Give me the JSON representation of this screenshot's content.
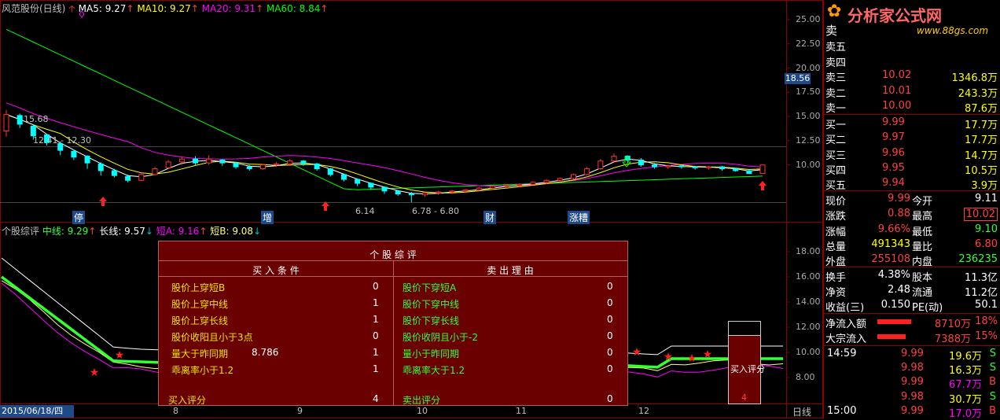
{
  "colors": {
    "up": "#ff3232",
    "down": "#00ffff",
    "ma5": "#ffffff",
    "ma10": "#ffff00",
    "ma20": "#ff00ff",
    "ma60": "#00ff00"
  },
  "header": {
    "title": "风范股份(日线)",
    "ma5": "MA5: 9.27",
    "ma10": "MA10: 9.27",
    "ma20": "MA20: 9.31",
    "ma60": "MA60: 8.84"
  },
  "price_axis": [
    "25.00",
    "22.50",
    "20.00",
    "17.50",
    "15.00",
    "12.50",
    "10.00"
  ],
  "price_marker": "18.56",
  "annotations": {
    "high": "15.68",
    "range": "12.41 - 12.30",
    "low": "6.14",
    "low2": "6.78 - 6.80"
  },
  "event_tags": [
    "停",
    "增",
    "财",
    "涨糟"
  ],
  "lower_header": {
    "name": "个股综评",
    "mid": "中线: 9.29",
    "long": "长线: 9.57",
    "shortA": "短A: 9.16",
    "shortB": "短B: 9.08"
  },
  "lower_axis": [
    "18.00",
    "16.00",
    "14.00",
    "12.00",
    "10.00",
    "8.00"
  ],
  "date_axis": {
    "current": "2015/06/18/四",
    "months": [
      "8",
      "9",
      "10",
      "11",
      "12"
    ],
    "period": "日线"
  },
  "popup": {
    "title": "个 股 综 评",
    "buy_header": "买 入 条 件",
    "sell_header": "卖 出 理 由",
    "buy": [
      {
        "label": "股价上穿短B",
        "extra": "",
        "value": "0"
      },
      {
        "label": "股价上穿中线",
        "extra": "",
        "value": "1"
      },
      {
        "label": "股价上穿长线",
        "extra": "",
        "value": "1"
      },
      {
        "label": "股价收阳且小于3点",
        "extra": "",
        "value": "0"
      },
      {
        "label": "量大于昨同期",
        "extra": "8.786",
        "value": "1"
      },
      {
        "label": "乖离率小于1.2",
        "extra": "",
        "value": "1"
      }
    ],
    "sell": [
      {
        "label": "股价下穿短A",
        "value": "0"
      },
      {
        "label": "股价下穿中线",
        "value": "0"
      },
      {
        "label": "股价下穿长线",
        "value": "0"
      },
      {
        "label": "股价收阴且小于-2",
        "value": "0"
      },
      {
        "label": "量小于昨同期",
        "value": "0"
      },
      {
        "label": "乖离率大于1.2",
        "value": "0"
      }
    ],
    "buy_score_label": "买入评分",
    "buy_score": "4",
    "sell_score_label": "卖出评分",
    "sell_score": "0"
  },
  "score_box": {
    "label": "买入评分",
    "value": "4"
  },
  "logo": {
    "title": "分析家公式网",
    "url": "www.88gs.com"
  },
  "orderbook": {
    "sell": [
      {
        "label": "卖五",
        "price": "",
        "vol": ""
      },
      {
        "label": "卖四",
        "price": "",
        "vol": ""
      },
      {
        "label": "卖三",
        "price": "10.02",
        "vol": "1346.8万"
      },
      {
        "label": "卖二",
        "price": "10.01",
        "vol": "243.3万"
      },
      {
        "label": "卖一",
        "price": "10.00",
        "vol": "87.6万"
      }
    ],
    "buy": [
      {
        "label": "买一",
        "price": "9.99",
        "vol": "17.7万"
      },
      {
        "label": "买二",
        "price": "9.97",
        "vol": "17.7万"
      },
      {
        "label": "买三",
        "price": "9.96",
        "vol": "14.7万"
      },
      {
        "label": "买四",
        "price": "9.95",
        "vol": "10.5万"
      },
      {
        "label": "买五",
        "price": "9.94",
        "vol": "3.9万"
      }
    ]
  },
  "quote": [
    {
      "l1": "现价",
      "v1": "9.99",
      "l2": "今开",
      "v2": "9.11"
    },
    {
      "l1": "涨跌",
      "v1": "0.88",
      "l2": "最高",
      "v2": "10.02"
    },
    {
      "l1": "涨幅",
      "v1": "9.66%",
      "l2": "最低",
      "v2": "9.10"
    },
    {
      "l1": "总量",
      "v1": "491343",
      "l2": "量比",
      "v2": "6.80"
    },
    {
      "l1": "外盘",
      "v1": "255108",
      "l2": "内盘",
      "v2": "236235"
    }
  ],
  "stats": [
    {
      "l1": "换手",
      "v1": "4.38%",
      "l2": "股本",
      "v2": "11.3亿"
    },
    {
      "l1": "净资",
      "v1": "2.48",
      "l2": "流通",
      "v2": "11.2亿"
    },
    {
      "l1": "收益(三)",
      "v1": "0.150",
      "l2": "PE(动)",
      "v2": "50.1"
    }
  ],
  "flows": [
    {
      "label": "净流入额",
      "value": "8710万",
      "pct": "18%",
      "fill": 0.9
    },
    {
      "label": "大宗流入",
      "value": "7388万",
      "pct": "15%",
      "fill": 0.75
    }
  ],
  "ticks": [
    {
      "time": "14:59",
      "price": "9.99",
      "vol": "19.6万",
      "side": "S"
    },
    {
      "time": "",
      "price": "9.98",
      "vol": "16.3万",
      "side": "S"
    },
    {
      "time": "",
      "price": "9.99",
      "vol": "67.7万",
      "side": "B"
    },
    {
      "time": "",
      "price": "9.98",
      "vol": "30.7万",
      "side": "S"
    },
    {
      "time": "15:00",
      "price": "9.99",
      "vol": "17.0万",
      "side": "B"
    }
  ],
  "chart_data": {
    "type": "candlestick",
    "price_range": [
      6,
      26
    ],
    "candles": [
      [
        13.5,
        15.2,
        12.9,
        15.68
      ],
      [
        15.1,
        14.2,
        13.8,
        15.3
      ],
      [
        14.0,
        13.0,
        12.6,
        14.2
      ],
      [
        13.1,
        12.3,
        12.0,
        13.2
      ],
      [
        12.2,
        11.5,
        11.0,
        12.4
      ],
      [
        11.4,
        10.8,
        10.5,
        11.6
      ],
      [
        10.9,
        10.2,
        9.6,
        11.0
      ],
      [
        10.1,
        9.4,
        8.9,
        10.3
      ],
      [
        9.4,
        8.9,
        8.7,
        9.6
      ],
      [
        8.8,
        8.4,
        8.2,
        9.0
      ],
      [
        8.4,
        9.0,
        8.3,
        9.2
      ],
      [
        9.0,
        9.6,
        8.9,
        9.8
      ],
      [
        9.7,
        10.3,
        9.6,
        10.5
      ],
      [
        10.3,
        10.6,
        10.0,
        10.8
      ],
      [
        10.6,
        10.2,
        9.9,
        10.9
      ],
      [
        10.2,
        10.6,
        10.0,
        11.0
      ],
      [
        10.5,
        10.2,
        9.9,
        10.6
      ],
      [
        10.2,
        9.8,
        9.6,
        10.3
      ],
      [
        9.8,
        9.6,
        9.4,
        10.0
      ],
      [
        9.6,
        10.0,
        9.5,
        10.1
      ],
      [
        10.0,
        10.1,
        9.8,
        10.3
      ],
      [
        10.1,
        10.4,
        9.9,
        10.6
      ],
      [
        10.4,
        10.1,
        9.9,
        10.5
      ],
      [
        10.1,
        9.6,
        9.4,
        10.2
      ],
      [
        9.6,
        9.0,
        8.8,
        9.7
      ],
      [
        9.0,
        8.5,
        8.3,
        9.1
      ],
      [
        8.5,
        8.1,
        7.8,
        8.6
      ],
      [
        8.1,
        7.7,
        7.4,
        8.2
      ],
      [
        7.7,
        7.3,
        7.0,
        7.8
      ],
      [
        7.3,
        7.0,
        6.8,
        7.4
      ],
      [
        7.0,
        6.9,
        6.14,
        7.2
      ],
      [
        6.9,
        7.1,
        6.7,
        7.2
      ],
      [
        7.1,
        7.2,
        6.9,
        7.3
      ],
      [
        7.2,
        7.3,
        7.0,
        7.4
      ],
      [
        7.3,
        7.4,
        7.1,
        7.5
      ],
      [
        7.4,
        7.6,
        7.3,
        7.7
      ],
      [
        7.6,
        7.8,
        7.4,
        7.9
      ],
      [
        7.8,
        7.9,
        7.6,
        8.0
      ],
      [
        7.9,
        8.0,
        7.7,
        8.1
      ],
      [
        8.0,
        8.2,
        7.9,
        8.3
      ],
      [
        8.2,
        8.4,
        8.0,
        8.5
      ],
      [
        8.4,
        8.6,
        8.2,
        8.7
      ],
      [
        8.6,
        9.0,
        8.5,
        9.1
      ],
      [
        9.0,
        9.6,
        8.9,
        9.8
      ],
      [
        9.6,
        10.4,
        9.5,
        10.6
      ],
      [
        10.4,
        10.9,
        10.2,
        11.2
      ],
      [
        10.9,
        10.5,
        10.2,
        11.0
      ],
      [
        10.5,
        10.0,
        9.8,
        10.7
      ],
      [
        10.0,
        9.8,
        9.6,
        10.2
      ],
      [
        9.8,
        9.9,
        9.6,
        10.0
      ],
      [
        9.9,
        9.8,
        9.6,
        10.0
      ],
      [
        9.8,
        9.7,
        9.5,
        9.9
      ],
      [
        9.7,
        9.8,
        9.5,
        9.9
      ],
      [
        9.8,
        9.6,
        9.4,
        9.9
      ],
      [
        9.6,
        9.4,
        9.3,
        9.7
      ],
      [
        9.4,
        9.11,
        9.1,
        9.5
      ],
      [
        9.11,
        9.99,
        9.1,
        10.02
      ]
    ]
  }
}
